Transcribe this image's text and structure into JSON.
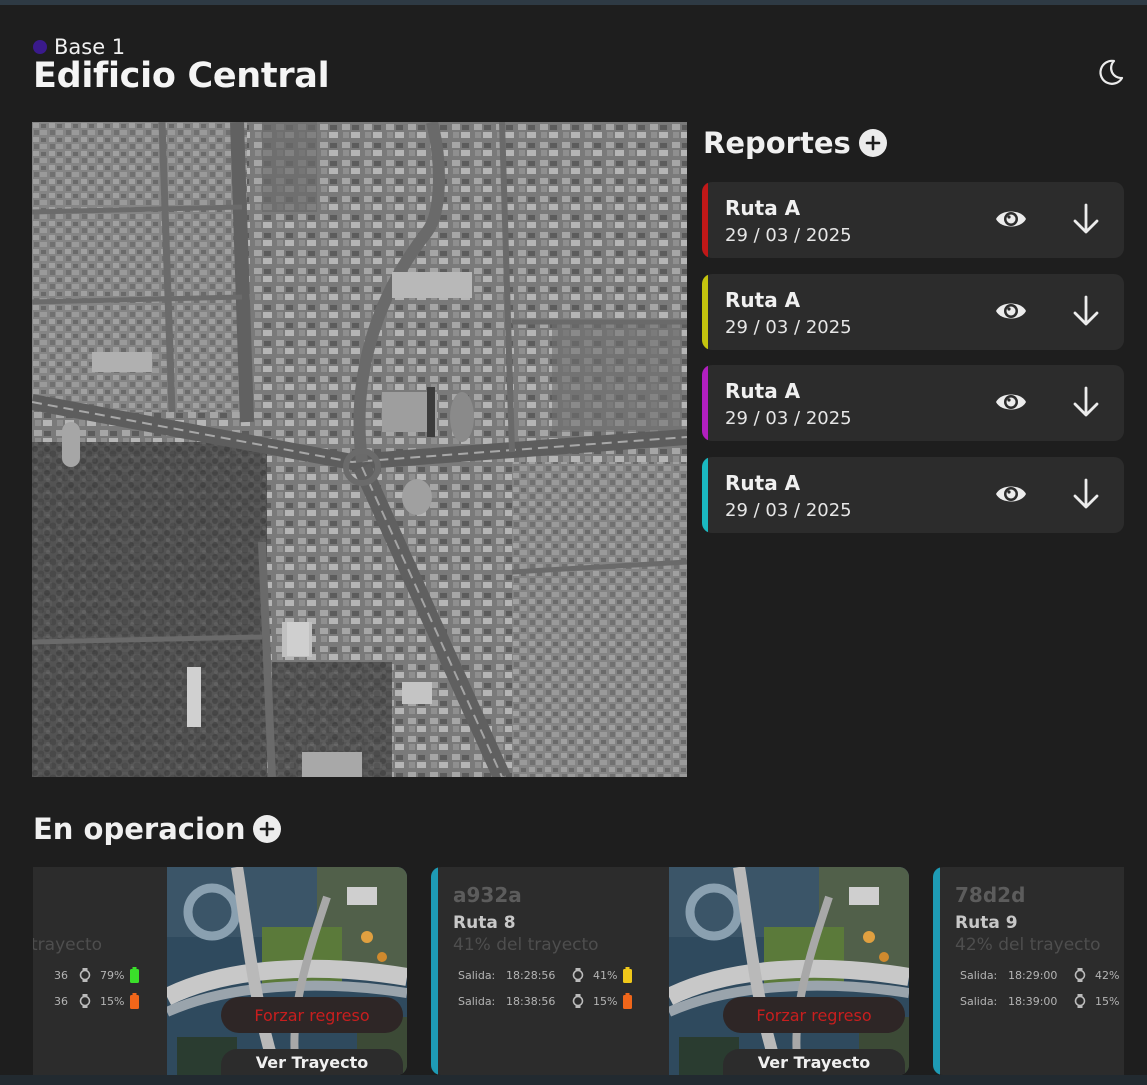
{
  "header": {
    "base_label": "Base 1",
    "title": "Edificio Central",
    "base_dot_color": "#3a1a8c",
    "theme_icon": "moon-icon"
  },
  "map": {
    "description_icon": "satellite-map"
  },
  "reports": {
    "title": "Reportes",
    "items": [
      {
        "route": "Ruta A",
        "date": "29 / 03 / 2025",
        "color": "#c01818"
      },
      {
        "route": "Ruta A",
        "date": "29 / 03 / 2025",
        "color": "#c4c40e"
      },
      {
        "route": "Ruta A",
        "date": "29 / 03 / 2025",
        "color": "#b21fc0"
      },
      {
        "route": "Ruta A",
        "date": "29 / 03 / 2025",
        "color": "#1ab8c0"
      }
    ]
  },
  "operations": {
    "title": "En operacion",
    "cards": [
      {
        "id": "",
        "route": "",
        "progress": "trayecto",
        "rows": [
          {
            "label": "",
            "time": "36",
            "pct": "79%",
            "battery": "#3adf2a"
          },
          {
            "label": "",
            "time": "36",
            "pct": "15%",
            "battery": "#f0661a"
          }
        ],
        "force_label": "Forzar regreso",
        "route_label": "Ver Trayecto"
      },
      {
        "id": "a932a",
        "route": "Ruta 8",
        "progress": "41% del trayecto",
        "rows": [
          {
            "label": "Salida:",
            "time": "18:28:56",
            "pct": "41%",
            "battery": "#f0c81a"
          },
          {
            "label": "Salida:",
            "time": "18:38:56",
            "pct": "15%",
            "battery": "#f0661a"
          }
        ],
        "force_label": "Forzar regreso",
        "route_label": "Ver Trayecto"
      },
      {
        "id": "78d2d",
        "route": "Ruta 9",
        "progress": "42% del trayecto",
        "rows": [
          {
            "label": "Salida:",
            "time": "18:29:00",
            "pct": "42%",
            "battery": ""
          },
          {
            "label": "Salida:",
            "time": "18:39:00",
            "pct": "15%",
            "battery": ""
          }
        ],
        "force_label": "",
        "route_label": ""
      }
    ]
  },
  "icons": {
    "add": "plus-circle-icon",
    "view": "eye-icon",
    "download": "arrow-down-icon",
    "watch": "watch-icon",
    "battery": "battery-icon"
  }
}
